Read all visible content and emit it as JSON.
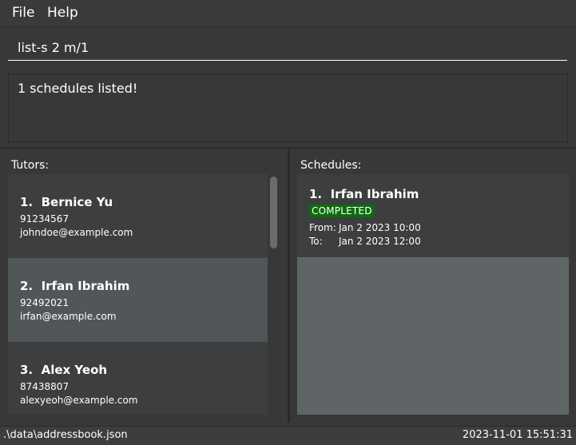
{
  "menu": {
    "items": [
      {
        "label": "File"
      },
      {
        "label": "Help"
      }
    ]
  },
  "command": {
    "value": "list-s 2 m/1"
  },
  "result": {
    "text": "1 schedules listed!"
  },
  "tutors": {
    "heading": "Tutors:",
    "items": [
      {
        "index": "1.",
        "name": "Bernice Yu",
        "phone": "91234567",
        "email": "johndoe@example.com"
      },
      {
        "index": "2.",
        "name": "Irfan Ibrahim",
        "phone": "92492021",
        "email": "irfan@example.com"
      },
      {
        "index": "3.",
        "name": "Alex Yeoh",
        "phone": "87438807",
        "email": "alexyeoh@example.com"
      }
    ]
  },
  "schedules": {
    "heading": "Schedules:",
    "items": [
      {
        "index": "1.",
        "tutor": "Irfan Ibrahim",
        "status": "COMPLETED",
        "from_label": "From:",
        "from": "Jan 2 2023 10:00",
        "to_label": "To:",
        "to": "Jan 2 2023 12:00"
      }
    ]
  },
  "statusbar": {
    "file_path": ".\\data\\addressbook.json",
    "timestamp": "2023-11-01 15:51:31"
  },
  "colors": {
    "background": "#383838",
    "selected_card": "#515658",
    "card": "#3c3e3f",
    "status_completed": "#0b6e0b"
  }
}
